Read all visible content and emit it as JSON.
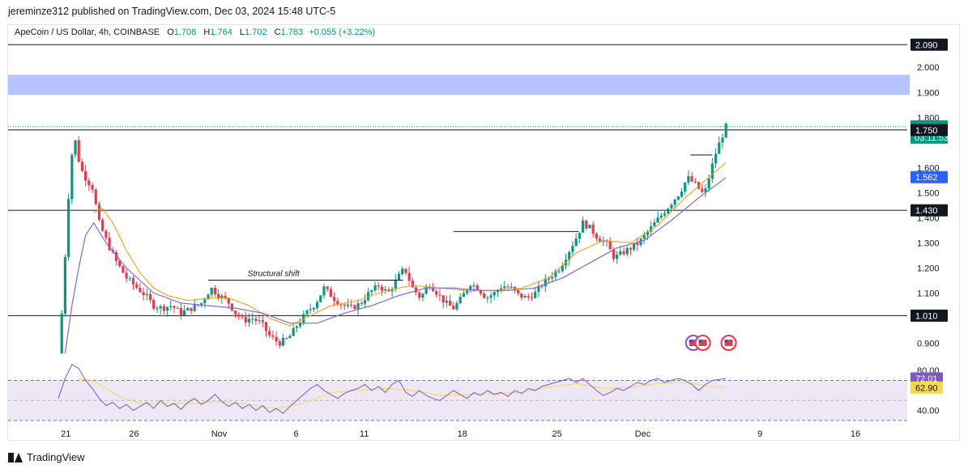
{
  "header": {
    "publisher_line": "jereminze312 published on TradingView.com, Dec 03, 2024 15:48 UTC-5"
  },
  "legend": {
    "symbol": "ApeCoin / US Dollar, 4h, COINBASE",
    "o_label": "O",
    "o_value": "1.708",
    "h_label": "H",
    "h_value": "1.764",
    "l_label": "L",
    "l_value": "1.702",
    "c_label": "C",
    "c_value": "1.763",
    "change": "+0.055 (+3.22%)"
  },
  "footer": {
    "brand": "TradingView"
  },
  "colors": {
    "up": "#089981",
    "down": "#f23645",
    "ma": "#ff9800",
    "ma_long": "#7b68ee",
    "zone": "#a8b8ff",
    "rsi": "#7e57c2",
    "rsi_ma": "#f7d94c",
    "rsi_band": "#ede7f6"
  },
  "chart_data": [
    {
      "type": "candlestick",
      "title": "ApeCoin / US Dollar, 4h, COINBASE",
      "ylim": [
        0.85,
        2.12
      ],
      "x_ticks": [
        "21",
        "26",
        "Nov",
        "6",
        "11",
        "18",
        "25",
        "Dec",
        "9",
        "16"
      ],
      "y_ticks": [
        "2.000",
        "1.900",
        "1.800",
        "1.600",
        "1.500",
        "1.300",
        "1.200",
        "1.100",
        "0.900"
      ],
      "price_labels": [
        {
          "value": 2.09,
          "text": "2.090",
          "style": "dark"
        },
        {
          "value": 1.763,
          "text": "1.763",
          "sub": "03:11:53",
          "style": "current"
        },
        {
          "value": 1.75,
          "text": "1.750",
          "style": "dark"
        },
        {
          "value": 1.562,
          "text": "1.562",
          "style": "blue"
        },
        {
          "value": 1.43,
          "text": "1.430",
          "style": "dark"
        },
        {
          "value": 1.4,
          "text": "1.400",
          "style": "tick"
        },
        {
          "value": 1.01,
          "text": "1.010",
          "style": "dark"
        }
      ],
      "horizontal_levels": [
        2.09,
        1.75,
        1.43,
        1.01
      ],
      "supply_zone": [
        1.89,
        1.97
      ],
      "annotations": [
        {
          "text": "Structural shift",
          "x_day": 13.9,
          "y": 1.145,
          "line_from": 11.0,
          "line_to": 25.3
        }
      ],
      "price_path": [
        [
          0,
          0.86
        ],
        [
          0.3,
          1.05
        ],
        [
          0.6,
          1.35
        ],
        [
          0.9,
          1.62
        ],
        [
          1.2,
          1.72
        ],
        [
          1.6,
          1.6
        ],
        [
          2.0,
          1.56
        ],
        [
          2.5,
          1.52
        ],
        [
          3.0,
          1.38
        ],
        [
          3.6,
          1.3
        ],
        [
          4.2,
          1.23
        ],
        [
          5.0,
          1.16
        ],
        [
          5.8,
          1.12
        ],
        [
          6.4,
          1.09
        ],
        [
          7.0,
          1.05
        ],
        [
          7.6,
          1.04
        ],
        [
          8.3,
          1.05
        ],
        [
          9.0,
          1.02
        ],
        [
          9.8,
          1.04
        ],
        [
          10.5,
          1.06
        ],
        [
          11.2,
          1.12
        ],
        [
          11.8,
          1.09
        ],
        [
          12.4,
          1.07
        ],
        [
          13.0,
          1.02
        ],
        [
          13.6,
          0.99
        ],
        [
          14.2,
          1.0
        ],
        [
          14.9,
          0.98
        ],
        [
          15.5,
          0.93
        ],
        [
          16.2,
          0.9
        ],
        [
          16.9,
          0.92
        ],
        [
          17.5,
          0.97
        ],
        [
          18.2,
          1.02
        ],
        [
          18.9,
          1.06
        ],
        [
          19.5,
          1.12
        ],
        [
          20.2,
          1.08
        ],
        [
          20.9,
          1.05
        ],
        [
          21.5,
          1.04
        ],
        [
          22.2,
          1.06
        ],
        [
          22.8,
          1.1
        ],
        [
          23.5,
          1.13
        ],
        [
          24.2,
          1.1
        ],
        [
          24.8,
          1.15
        ],
        [
          25.4,
          1.2
        ],
        [
          26.0,
          1.12
        ],
        [
          26.6,
          1.08
        ],
        [
          27.2,
          1.14
        ],
        [
          27.8,
          1.1
        ],
        [
          28.4,
          1.06
        ],
        [
          29.0,
          1.04
        ],
        [
          29.6,
          1.08
        ],
        [
          30.2,
          1.14
        ],
        [
          30.8,
          1.12
        ],
        [
          31.4,
          1.08
        ],
        [
          32.0,
          1.1
        ],
        [
          32.6,
          1.13
        ],
        [
          33.2,
          1.12
        ],
        [
          33.8,
          1.09
        ],
        [
          34.4,
          1.08
        ],
        [
          35.0,
          1.1
        ],
        [
          35.6,
          1.14
        ],
        [
          36.2,
          1.17
        ],
        [
          36.8,
          1.2
        ],
        [
          37.4,
          1.26
        ],
        [
          38.0,
          1.32
        ],
        [
          38.5,
          1.38
        ],
        [
          39.0,
          1.36
        ],
        [
          39.6,
          1.32
        ],
        [
          40.2,
          1.3
        ],
        [
          40.8,
          1.24
        ],
        [
          41.4,
          1.26
        ],
        [
          42.0,
          1.28
        ],
        [
          42.6,
          1.3
        ],
        [
          43.2,
          1.34
        ],
        [
          43.8,
          1.38
        ],
        [
          44.4,
          1.42
        ],
        [
          45.0,
          1.46
        ],
        [
          45.6,
          1.5
        ],
        [
          46.2,
          1.56
        ],
        [
          46.8,
          1.53
        ],
        [
          47.4,
          1.49
        ],
        [
          47.8,
          1.57
        ],
        [
          48.2,
          1.65
        ],
        [
          48.6,
          1.71
        ],
        [
          49.0,
          1.763
        ]
      ],
      "ma_path": [
        [
          2.6,
          1.42
        ],
        [
          3.2,
          1.44
        ],
        [
          4.0,
          1.38
        ],
        [
          5.0,
          1.27
        ],
        [
          6.0,
          1.18
        ],
        [
          7.0,
          1.12
        ],
        [
          8.0,
          1.09
        ],
        [
          9.5,
          1.07
        ],
        [
          11.0,
          1.08
        ],
        [
          12.5,
          1.08
        ],
        [
          14.0,
          1.05
        ],
        [
          15.5,
          1.0
        ],
        [
          17.0,
          0.97
        ],
        [
          18.5,
          1.01
        ],
        [
          20.0,
          1.05
        ],
        [
          22.0,
          1.07
        ],
        [
          24.0,
          1.11
        ],
        [
          26.0,
          1.13
        ],
        [
          28.0,
          1.12
        ],
        [
          30.0,
          1.11
        ],
        [
          32.0,
          1.11
        ],
        [
          34.0,
          1.12
        ],
        [
          36.0,
          1.16
        ],
        [
          38.0,
          1.26
        ],
        [
          40.0,
          1.31
        ],
        [
          42.0,
          1.3
        ],
        [
          44.0,
          1.37
        ],
        [
          46.0,
          1.48
        ],
        [
          47.5,
          1.55
        ],
        [
          49.0,
          1.62
        ]
      ],
      "ma_long_path": [
        [
          0.5,
          0.86
        ],
        [
          1.0,
          1.05
        ],
        [
          1.5,
          1.2
        ],
        [
          2.0,
          1.33
        ],
        [
          2.6,
          1.38
        ],
        [
          3.5,
          1.3
        ],
        [
          5.0,
          1.2
        ],
        [
          7.0,
          1.1
        ],
        [
          9.0,
          1.06
        ],
        [
          11.0,
          1.05
        ],
        [
          13.0,
          1.04
        ],
        [
          15.0,
          1.02
        ],
        [
          17.0,
          0.98
        ],
        [
          19.0,
          0.98
        ],
        [
          21.0,
          1.02
        ],
        [
          23.0,
          1.05
        ],
        [
          25.0,
          1.09
        ],
        [
          27.0,
          1.12
        ],
        [
          29.0,
          1.12
        ],
        [
          31.0,
          1.11
        ],
        [
          33.0,
          1.11
        ],
        [
          35.0,
          1.12
        ],
        [
          37.0,
          1.16
        ],
        [
          39.0,
          1.22
        ],
        [
          41.0,
          1.28
        ],
        [
          43.0,
          1.31
        ],
        [
          45.0,
          1.39
        ],
        [
          47.0,
          1.48
        ],
        [
          49.0,
          1.56
        ]
      ]
    },
    {
      "type": "line",
      "title": "RSI",
      "ylim": [
        30,
        85
      ],
      "y_ticks": [
        "80.00",
        "40.00"
      ],
      "price_labels": [
        {
          "value": 72.01,
          "text": "72.01",
          "style": "rsi"
        },
        {
          "value": 62.9,
          "text": "62.90",
          "style": "rsi_ma"
        }
      ],
      "band": [
        30,
        70
      ],
      "rsi_path": [
        [
          0,
          52
        ],
        [
          0.5,
          72
        ],
        [
          1.0,
          86
        ],
        [
          1.5,
          82
        ],
        [
          2.0,
          70
        ],
        [
          2.5,
          62
        ],
        [
          3.0,
          52
        ],
        [
          3.5,
          45
        ],
        [
          4.0,
          48
        ],
        [
          4.5,
          42
        ],
        [
          5.0,
          46
        ],
        [
          5.5,
          40
        ],
        [
          6.0,
          44
        ],
        [
          6.5,
          48
        ],
        [
          7.0,
          42
        ],
        [
          7.5,
          50
        ],
        [
          8.0,
          44
        ],
        [
          8.5,
          47
        ],
        [
          9.0,
          41
        ],
        [
          9.5,
          48
        ],
        [
          10.0,
          52
        ],
        [
          10.5,
          46
        ],
        [
          11.0,
          50
        ],
        [
          11.5,
          56
        ],
        [
          12.0,
          49
        ],
        [
          12.5,
          44
        ],
        [
          13.0,
          48
        ],
        [
          13.5,
          42
        ],
        [
          14.0,
          46
        ],
        [
          14.5,
          40
        ],
        [
          15.0,
          45
        ],
        [
          15.5,
          38
        ],
        [
          16.0,
          42
        ],
        [
          16.5,
          37
        ],
        [
          17.0,
          44
        ],
        [
          17.5,
          50
        ],
        [
          18.0,
          56
        ],
        [
          18.5,
          62
        ],
        [
          19.0,
          66
        ],
        [
          19.5,
          60
        ],
        [
          20.0,
          56
        ],
        [
          20.5,
          52
        ],
        [
          21.0,
          57
        ],
        [
          21.5,
          60
        ],
        [
          22.0,
          62
        ],
        [
          22.5,
          66
        ],
        [
          23.0,
          60
        ],
        [
          23.5,
          64
        ],
        [
          24.0,
          58
        ],
        [
          24.5,
          66
        ],
        [
          25.0,
          70
        ],
        [
          25.5,
          58
        ],
        [
          26.0,
          54
        ],
        [
          26.5,
          60
        ],
        [
          27.0,
          55
        ],
        [
          27.5,
          52
        ],
        [
          28.0,
          50
        ],
        [
          28.5,
          55
        ],
        [
          29.0,
          60
        ],
        [
          29.5,
          56
        ],
        [
          30.0,
          52
        ],
        [
          30.5,
          58
        ],
        [
          31.0,
          55
        ],
        [
          31.5,
          60
        ],
        [
          32.0,
          56
        ],
        [
          32.5,
          58
        ],
        [
          33.0,
          54
        ],
        [
          33.5,
          60
        ],
        [
          34.0,
          57
        ],
        [
          34.5,
          62
        ],
        [
          35.0,
          60
        ],
        [
          35.5,
          64
        ],
        [
          36.0,
          66
        ],
        [
          36.5,
          68
        ],
        [
          37.0,
          70
        ],
        [
          37.5,
          72
        ],
        [
          38.0,
          68
        ],
        [
          38.5,
          72
        ],
        [
          39.0,
          66
        ],
        [
          39.5,
          60
        ],
        [
          40.0,
          55
        ],
        [
          40.5,
          58
        ],
        [
          41.0,
          62
        ],
        [
          41.5,
          60
        ],
        [
          42.0,
          64
        ],
        [
          42.5,
          68
        ],
        [
          43.0,
          66
        ],
        [
          43.5,
          70
        ],
        [
          44.0,
          72
        ],
        [
          44.5,
          68
        ],
        [
          45.0,
          70
        ],
        [
          45.5,
          72
        ],
        [
          46.0,
          70
        ],
        [
          46.5,
          66
        ],
        [
          47.0,
          60
        ],
        [
          47.5,
          66
        ],
        [
          48.0,
          70
        ],
        [
          48.5,
          71
        ],
        [
          49.0,
          72.01
        ]
      ],
      "rsi_ma_path": [
        [
          1.5,
          72
        ],
        [
          2.5,
          70
        ],
        [
          3.5,
          62
        ],
        [
          4.5,
          54
        ],
        [
          6.0,
          47
        ],
        [
          8.0,
          47
        ],
        [
          10.0,
          47
        ],
        [
          12.0,
          49
        ],
        [
          14.0,
          46
        ],
        [
          16.0,
          42
        ],
        [
          18.0,
          47
        ],
        [
          20.0,
          58
        ],
        [
          22.0,
          60
        ],
        [
          24.0,
          62
        ],
        [
          26.0,
          60
        ],
        [
          28.0,
          55
        ],
        [
          30.0,
          56
        ],
        [
          32.0,
          57
        ],
        [
          34.0,
          58
        ],
        [
          36.0,
          63
        ],
        [
          38.0,
          67
        ],
        [
          40.0,
          62
        ],
        [
          42.0,
          63
        ],
        [
          44.0,
          67
        ],
        [
          46.0,
          68
        ],
        [
          48.0,
          64
        ],
        [
          49.0,
          62.9
        ]
      ]
    }
  ]
}
